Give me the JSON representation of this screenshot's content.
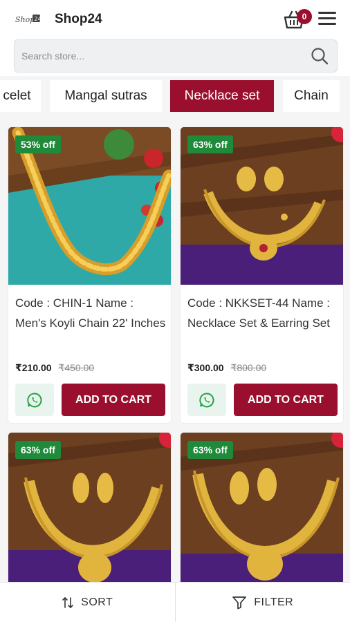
{
  "header": {
    "title": "Shop24",
    "cart_count": "0",
    "logo_icon": "shop-logo-icon",
    "cart_icon": "shopping-basket-icon",
    "menu_icon": "hamburger-menu-icon"
  },
  "search": {
    "placeholder": "Search store...",
    "value": "",
    "icon": "search-icon"
  },
  "categories": [
    {
      "label": "celet",
      "active": false
    },
    {
      "label": "Mangal sutras",
      "active": false
    },
    {
      "label": "Necklace set",
      "active": true
    },
    {
      "label": "Chain",
      "active": false
    }
  ],
  "products": [
    {
      "discount": "53% off",
      "title": "Code : CHIN-1 Name : Men's Koyli Chain 22' Inches",
      "price": "₹210.00",
      "old_price": "₹450.00",
      "cart_label": "ADD TO CART"
    },
    {
      "discount": "63% off",
      "title": "Code : NKKSET-44 Name : Necklace Set & Earring Set",
      "price": "₹300.00",
      "old_price": "₹800.00",
      "cart_label": "ADD TO CART"
    },
    {
      "discount": "63% off"
    },
    {
      "discount": "63% off"
    }
  ],
  "bottom_bar": {
    "sort_label": "SORT",
    "filter_label": "FILTER",
    "sort_icon": "sort-arrows-icon",
    "filter_icon": "funnel-icon"
  },
  "colors": {
    "brand": "#9b0f2e",
    "discount_badge": "#1e8a3a",
    "whatsapp": "#25a244"
  }
}
